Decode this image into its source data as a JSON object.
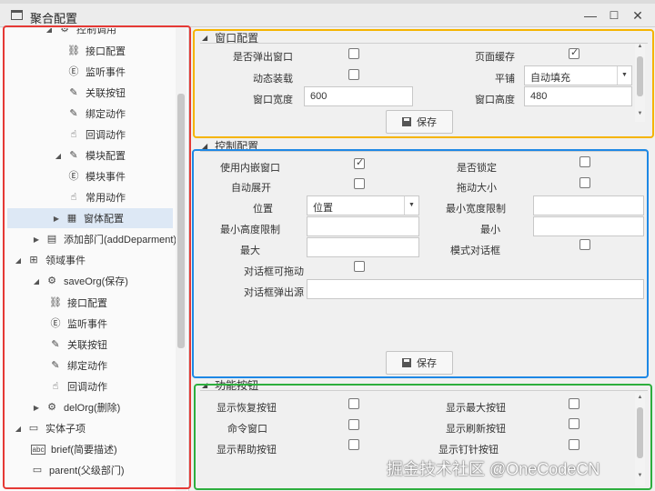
{
  "window": {
    "title": "聚合配置",
    "icons": {
      "window": "window-icon",
      "minimize": "minimize-icon",
      "maximize": "maximize-icon",
      "close": "close-icon"
    }
  },
  "tree": [
    {
      "label": "控制调用",
      "icon": "flow-icon",
      "arrow": "▲"
    },
    {
      "label": "接口配置",
      "icon": "link-icon"
    },
    {
      "label": "监听事件",
      "icon": "event-icon"
    },
    {
      "label": "关联按钮",
      "icon": "edit-icon"
    },
    {
      "label": "绑定动作",
      "icon": "edit-icon"
    },
    {
      "label": "回调动作",
      "icon": "hand-icon"
    },
    {
      "label": "模块配置",
      "icon": "module-icon",
      "arrow": "◢"
    },
    {
      "label": "模块事件",
      "icon": "event-icon"
    },
    {
      "label": "常用动作",
      "icon": "hand-icon"
    },
    {
      "label": "窗体配置",
      "icon": "form-icon",
      "arrow": "▶"
    },
    {
      "label": "添加部门(addDeparment)",
      "icon": "doc-icon",
      "arrow": "▶"
    },
    {
      "label": "领域事件",
      "icon": "domain-icon",
      "arrow": "◢"
    },
    {
      "label": "saveOrg(保存)",
      "icon": "flow-icon",
      "arrow": "◢"
    },
    {
      "label": "接口配置",
      "icon": "link-icon"
    },
    {
      "label": "监听事件",
      "icon": "event-icon"
    },
    {
      "label": "关联按钮",
      "icon": "edit-icon"
    },
    {
      "label": "绑定动作",
      "icon": "edit-icon"
    },
    {
      "label": "回调动作",
      "icon": "hand-icon"
    },
    {
      "label": "delOrg(删除)",
      "icon": "flow-icon",
      "arrow": "▶"
    },
    {
      "label": "实体子项",
      "icon": "entity-icon",
      "arrow": "◢"
    },
    {
      "label": "brief(简要描述)",
      "icon": "abc-icon"
    },
    {
      "label": "parent(父级部门)",
      "icon": "field-icon"
    }
  ],
  "window_config": {
    "title": "窗口配置",
    "popup_label": "是否弹出窗口",
    "popup_checked": false,
    "cache_label": "页面缓存",
    "cache_checked": true,
    "dynamic_label": "动态装载",
    "dynamic_checked": false,
    "tile_label": "平铺",
    "tile_value": "自动填充",
    "width_label": "窗口宽度",
    "width_value": "600",
    "height_label": "窗口高度",
    "height_value": "480",
    "save_label": "保存"
  },
  "control_config": {
    "title": "控制配置",
    "embedded_label": "使用内嵌窗口",
    "embedded_checked": true,
    "locked_label": "是否锁定",
    "locked_checked": false,
    "autoexpand_label": "自动展开",
    "autoexpand_checked": false,
    "dragsize_label": "拖动大小",
    "dragsize_checked": false,
    "position_label": "位置",
    "position_value": "位置",
    "minwidth_label": "最小宽度限制",
    "minwidth_value": "",
    "minheight_label": "最小高度限制",
    "minheight_value": "",
    "min_label": "最小",
    "min_value": "",
    "max_label": "最大",
    "max_value": "",
    "modal_label": "模式对话框",
    "modal_checked": false,
    "draggable_label": "对话框可拖动",
    "draggable_checked": false,
    "source_label": "对话框弹出源",
    "source_value": "",
    "save_label": "保存"
  },
  "function_buttons": {
    "title": "功能按钮",
    "restore_label": "显示恢复按钮",
    "restore_checked": false,
    "maximize_label": "显示最大按钮",
    "maximize_checked": false,
    "command_label": "命令窗口",
    "command_checked": false,
    "refresh_label": "显示刷新按钮",
    "refresh_checked": false,
    "help_label": "显示帮助按钮",
    "help_checked": false,
    "pin_label": "显示钉针按钮",
    "pin_checked": false
  },
  "watermark": "掘金技术社区 @OneCodeCN"
}
